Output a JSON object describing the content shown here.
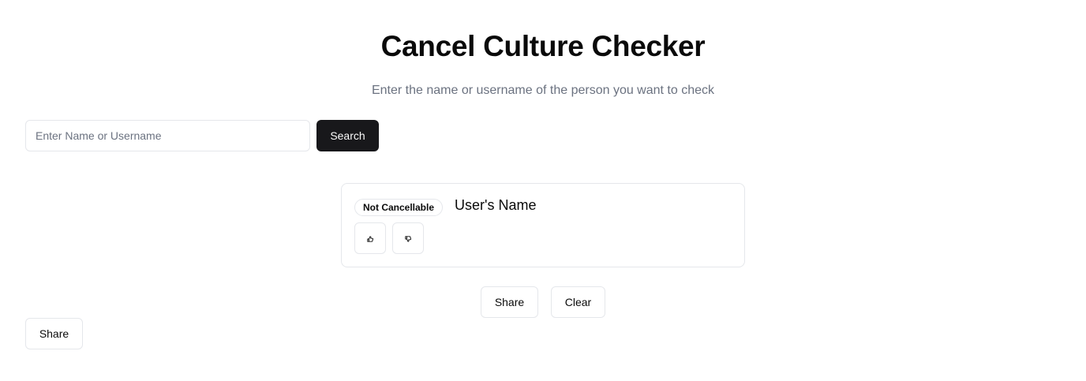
{
  "header": {
    "title": "Cancel Culture Checker",
    "subtitle": "Enter the name or username of the person you want to check"
  },
  "search": {
    "placeholder": "Enter Name or Username",
    "value": "",
    "button_label": "Search"
  },
  "result": {
    "status": "Not Cancellable",
    "name": "User's Name",
    "vote_up_icon": "thumbs-up-icon",
    "vote_down_icon": "thumbs-down-icon"
  },
  "actions": {
    "share_label": "Share",
    "clear_label": "Clear"
  },
  "footer": {
    "share_label": "Share"
  },
  "colors": {
    "primary_button": "#18181b",
    "border": "#e5e7eb",
    "muted_text": "#6b7280"
  }
}
